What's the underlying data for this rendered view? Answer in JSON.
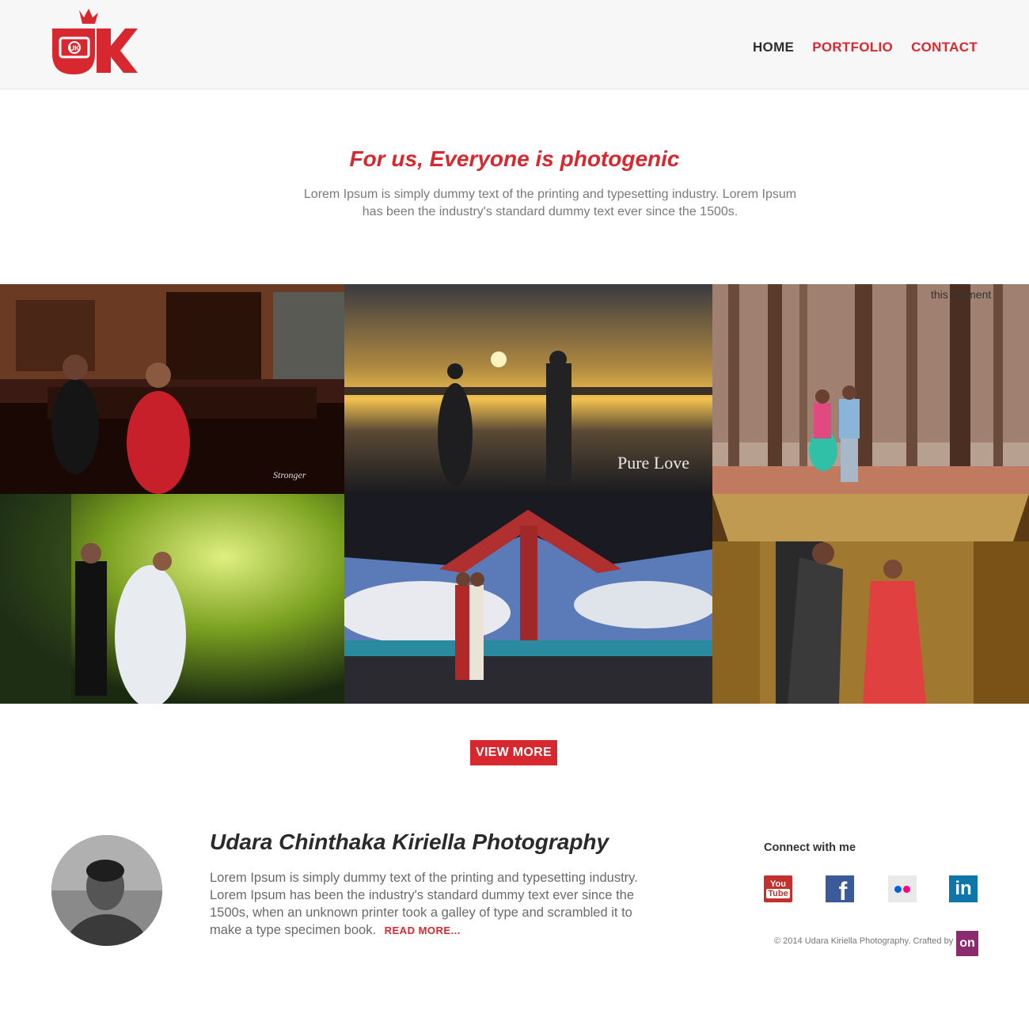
{
  "brand": {
    "logo_letters": "UK",
    "logo_mark": "camera-icon"
  },
  "nav": {
    "items": [
      {
        "label": "HOME",
        "active": true
      },
      {
        "label": "PORTFOLIO",
        "active": false
      },
      {
        "label": "CONTACT",
        "active": false
      }
    ]
  },
  "hero": {
    "title": "For us, Everyone is photogenic",
    "text": "Lorem Ipsum is simply dummy text of the printing and typesetting industry. Lorem Ipsum has been the industry's standard dummy text ever since the 1500s."
  },
  "gallery": {
    "overlays": [
      "Stronger",
      "Pure Love",
      "this moment"
    ]
  },
  "view_more": {
    "label": "VIEW MORE"
  },
  "about": {
    "title": "Udara Chinthaka Kiriella Photography",
    "text": "Lorem Ipsum is simply dummy text of the printing and typesetting industry. Lorem Ipsum has been the industry's standard dummy text ever since the 1500s, when an unknown printer took a galley of type and scrambled it to make a type specimen book.",
    "read_more": "READ MORE..."
  },
  "social": {
    "heading": "Connect with me",
    "youtube_top": "You",
    "youtube_bottom": "Tube",
    "facebook": "f",
    "linkedin": "in",
    "icons": [
      "youtube-icon",
      "facebook-icon",
      "flickr-icon",
      "linkedin-icon"
    ]
  },
  "footer": {
    "copyright": "© 2014 Udara Kiriella Photography.  Crafted by",
    "crafted_mark": "on"
  },
  "colors": {
    "accent": "#d7282f",
    "header_bg": "#f7f7f7"
  }
}
